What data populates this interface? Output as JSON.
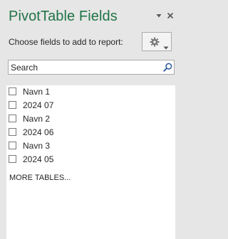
{
  "panel": {
    "title": "PivotTable Fields",
    "choose_label": "Choose fields to add to report:"
  },
  "header_icons": {
    "dropdown": "chevron-down-icon",
    "close": "close-icon"
  },
  "settings": {
    "icon": "gear-icon",
    "dropdown_icon": "chevron-down-icon"
  },
  "search": {
    "placeholder": "Search",
    "value": "",
    "icon": "search-icon"
  },
  "fields": [
    {
      "label": "Navn 1",
      "checked": false
    },
    {
      "label": "2024 07",
      "checked": false
    },
    {
      "label": "Navn 2",
      "checked": false
    },
    {
      "label": "2024 06",
      "checked": false
    },
    {
      "label": "Navn 3",
      "checked": false
    },
    {
      "label": "2024 05",
      "checked": false
    }
  ],
  "more_tables": "MORE TABLES...",
  "colors": {
    "accent": "#217346",
    "panel_bg": "#e6e6e6",
    "list_bg": "#ffffff"
  }
}
